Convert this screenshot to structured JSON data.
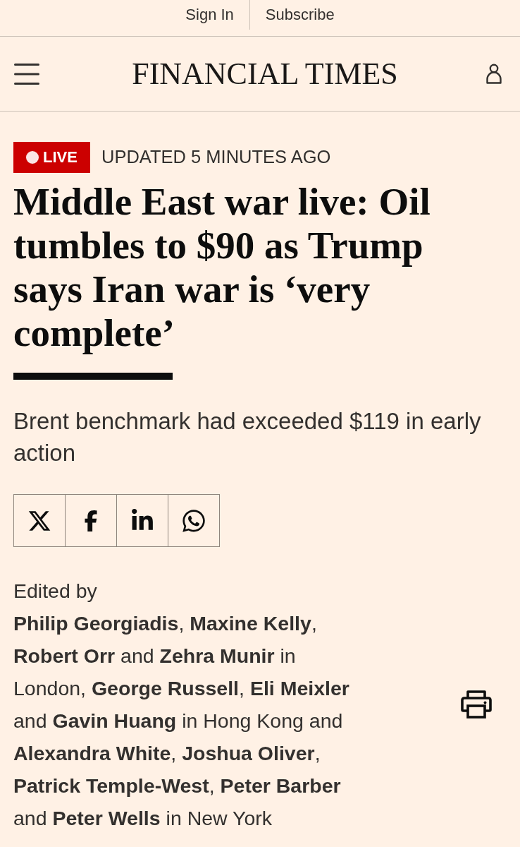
{
  "top_bar": {
    "links": [
      "Sign In",
      "Subscribe"
    ]
  },
  "header": {
    "logo": "FINANCIAL TIMES"
  },
  "article": {
    "live_badge": "LIVE",
    "updated": "UPDATED 5 MINUTES AGO",
    "headline": "Middle East war live: Oil tumbles to $90 as Trump says Iran war is ‘very complete’",
    "standfirst": "Brent benchmark had exceeded $119 in early action"
  },
  "byline": {
    "label": "Edited by",
    "text": "**Philip Georgiadis**, **Maxine Kelly**, **Robert Orr** and **Zehra Munir** in London, **George Russell**, **Eli Meixler** and **Gavin Huang** in Hong Kong and **Alexandra White**, **Joshua Oliver**, **Patrick Temple-West**, **Peter Barber** and **Peter Wells** in New York"
  }
}
